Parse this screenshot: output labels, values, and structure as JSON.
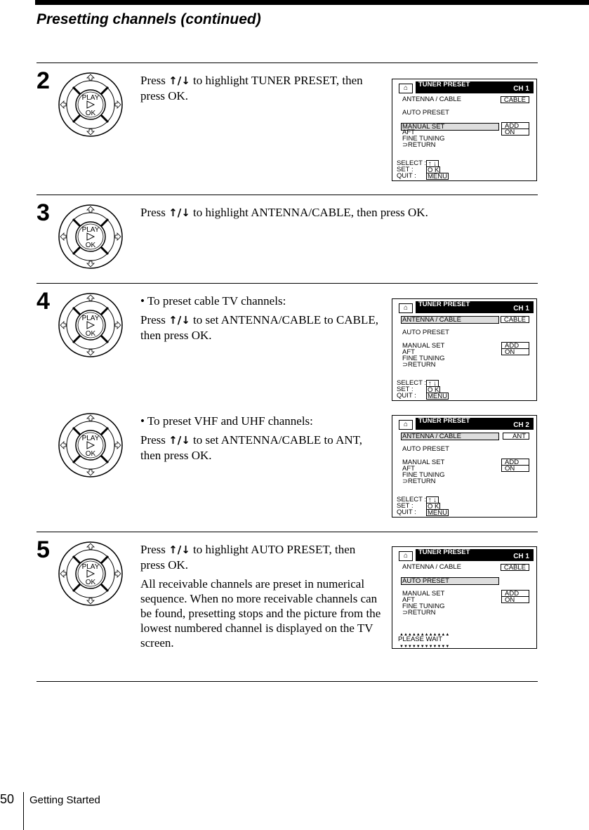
{
  "header": {
    "title": "Presetting channels (continued)"
  },
  "remote": {
    "play": "PLAY",
    "ok": "OK"
  },
  "steps": [
    {
      "number": "2",
      "paragraphs": [
        [
          "Press ",
          "↑/↓",
          " to highlight TUNER PRESET, then press OK."
        ]
      ]
    },
    {
      "number": "3",
      "paragraphs": [
        [
          "Press ",
          "↑/↓",
          " to highlight ANTENNA/CABLE, then press OK."
        ]
      ]
    },
    {
      "number": "4",
      "paragraphs": [
        [
          "• To preset cable TV channels:"
        ],
        [
          "Press ",
          "↑/↓",
          " to set ANTENNA/CABLE to CABLE, then press OK."
        ]
      ]
    },
    {
      "number": "",
      "paragraphs": [
        [
          "• To preset VHF and UHF channels:"
        ],
        [
          "Press ",
          "↑/↓",
          " to set ANTENNA/CABLE to ANT, then press OK."
        ]
      ]
    },
    {
      "number": "5",
      "paragraphs": [
        [
          "Press ",
          "↑/↓",
          " to highlight AUTO PRESET, then press OK."
        ],
        [
          "All receivable channels are preset in numerical sequence.  When no more receivable channels can be found, presetting stops and the picture from the lowest numbered channel is displayed on the TV screen."
        ]
      ]
    }
  ],
  "screens": [
    {
      "title": "TUNER  PRESET",
      "ch": "CH    1",
      "antenna_value": "CABLE",
      "highlight": "manual",
      "footer": "select"
    },
    {
      "title": "TUNER  PRESET",
      "ch": "CH    1",
      "antenna_value": "CABLE",
      "highlight": "antenna",
      "footer": "select"
    },
    {
      "title": "TUNER  PRESET",
      "ch": "CH    2",
      "antenna_value": "ANT",
      "highlight": "antenna",
      "footer": "select"
    },
    {
      "title": "TUNER  PRESET",
      "ch": "CH    1",
      "antenna_value": "CABLE",
      "highlight": "auto",
      "footer": "wait"
    }
  ],
  "menu": {
    "antenna": "ANTENNA / CABLE",
    "auto": "AUTO  PRESET",
    "manual": "MANUAL  SET",
    "aft": "AFT",
    "fine": "FINE  TUNING",
    "return": "RETURN",
    "add": "ADD",
    "on": "ON",
    "select": "SELECT :",
    "set": "SET      :",
    "quit": "QUIT     :",
    "select_key": "↑  ↓",
    "set_key": "O K",
    "quit_key": "MENU",
    "wait": "PLEASE   WAIT"
  },
  "footer": {
    "page": "50",
    "section": "Getting Started"
  }
}
